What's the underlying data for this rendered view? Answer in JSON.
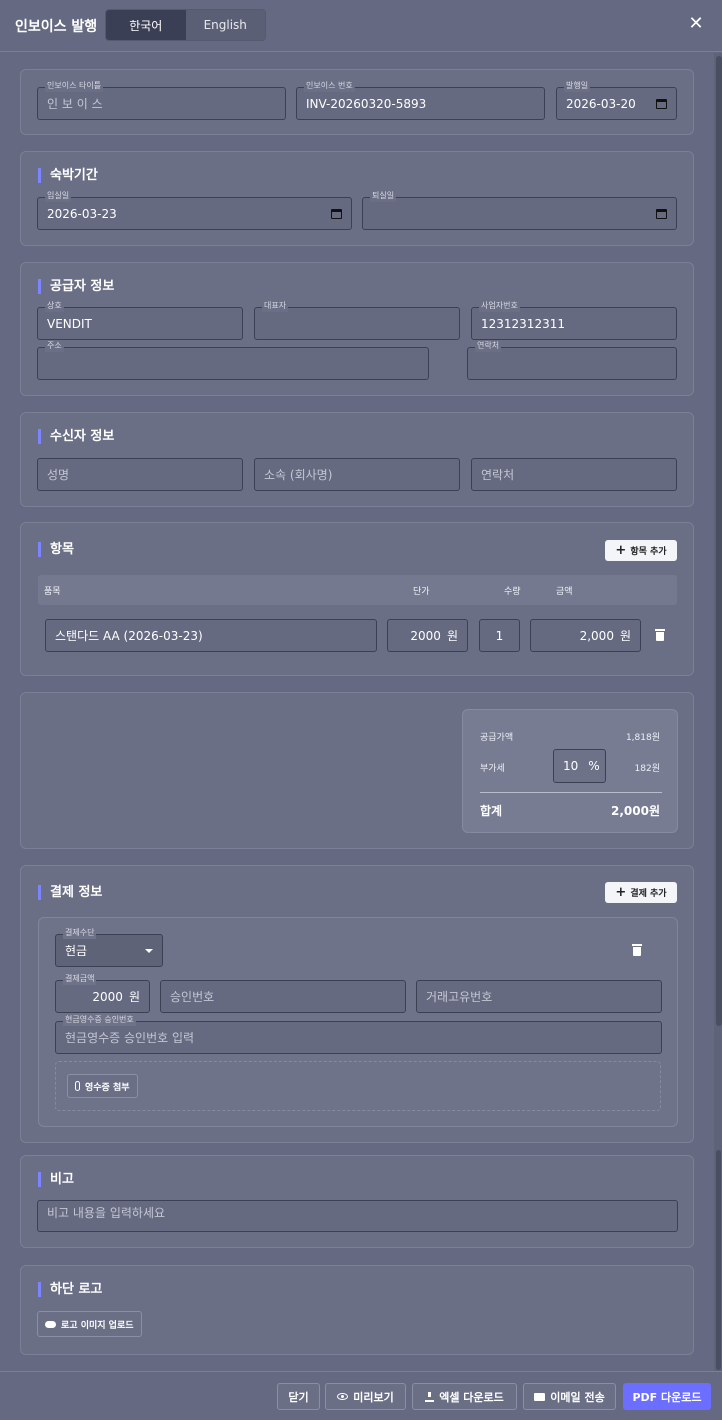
{
  "header": {
    "title": "인보이스 발행",
    "lang_ko": "한국어",
    "lang_en": "English",
    "close": "✕"
  },
  "basic": {
    "title_label": "인보이스 타이틀",
    "title_placeholder": "인 보 이 스",
    "number_label": "인보이스 번호",
    "number_value": "INV-20260320-5893",
    "issue_label": "발행일",
    "issue_value": "2026-03-20"
  },
  "stay": {
    "section": "숙박기간",
    "checkin_label": "입실일",
    "checkin_value": "2026-03-23",
    "checkout_label": "퇴실일"
  },
  "supplier": {
    "section": "공급자 정보",
    "company_label": "상호",
    "company_value": "VENDIT",
    "rep_label": "대표자",
    "bizno_label": "사업자번호",
    "bizno_value": "12312312311",
    "address_label": "주소",
    "contact_label": "연락처"
  },
  "recipient": {
    "section": "수신자 정보",
    "name_placeholder": "성명",
    "org_placeholder": "소속 (회사명)",
    "contact_placeholder": "연락처"
  },
  "items": {
    "section": "항목",
    "add_label": "항목 추가",
    "col_item": "품목",
    "col_price": "단가",
    "col_qty": "수량",
    "col_amount": "금액",
    "rows": [
      {
        "name": "스탠다드 AA (2026-03-23)",
        "price": "2000",
        "price_unit": "원",
        "qty": "1",
        "amount": "2,000",
        "amount_unit": "원"
      }
    ]
  },
  "summary": {
    "supply_label": "공급가액",
    "supply_value": "1,818원",
    "vat_label": "부가세",
    "vat_rate": "10",
    "vat_unit": "%",
    "vat_value": "182원",
    "total_label": "합계",
    "total_value": "2,000원"
  },
  "payment": {
    "section": "결제 정보",
    "add_label": "결제 추가",
    "method_label": "결제수단",
    "method_value": "현금",
    "amount_label": "결제금액",
    "amount_value": "2000",
    "amount_unit": "원",
    "approval_placeholder": "승인번호",
    "txid_placeholder": "거래고유번호",
    "receipt_label": "현금영수증 승인번호",
    "receipt_placeholder": "현금영수증 승인번호 입력",
    "attach_label": "영수증 첨부"
  },
  "notes": {
    "section": "비고",
    "placeholder": "비고 내용을 입력하세요"
  },
  "logo": {
    "section": "하단 로고",
    "upload_label": "로고 이미지 업로드"
  },
  "footer": {
    "close": "닫기",
    "preview": "미리보기",
    "excel": "엑셀 다운로드",
    "email": "이메일 전송",
    "pdf": "PDF 다운로드"
  }
}
